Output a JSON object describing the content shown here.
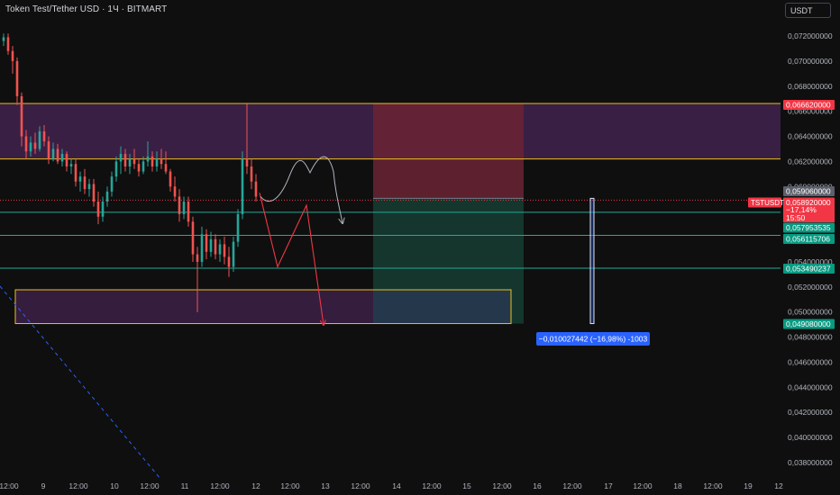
{
  "header": {
    "title": "Token Test/Tether USD · 1Ч · BITMART",
    "currency_button": "USDT"
  },
  "colors": {
    "up": "#26a69a",
    "down": "#ef5350",
    "zone_purple": "#3a1f44",
    "zone_red": "#6b2334",
    "zone_green": "#14362d",
    "line_yellow": "#e8c21a",
    "line_teal": "#22ab94",
    "line_red_dotted": "#f23645",
    "measure_blue": "#2962ff"
  },
  "chart_data": {
    "type": "candlestick",
    "symbol": "TSTUSDT",
    "y_ticks": [
      "0,072000000",
      "0,070000000",
      "0,068000000",
      "0,066000000",
      "0,064000000",
      "0,062000000",
      "0,060000000",
      "0,058000000",
      "0,056000000",
      "0,054000000",
      "0,052000000",
      "0,050000000",
      "0,048000000",
      "0,046000000",
      "0,044000000",
      "0,042000000",
      "0,040000000",
      "0,038000000"
    ],
    "x_ticks": [
      "12:00",
      "9",
      "12:00",
      "10",
      "12:00",
      "11",
      "12:00",
      "12",
      "12:00",
      "13",
      "12:00",
      "14",
      "12:00",
      "15",
      "12:00",
      "16",
      "12:00",
      "17",
      "12:00",
      "18",
      "12:00",
      "19",
      "12"
    ],
    "ylim": [
      0.0376,
      0.0738
    ],
    "levels": {
      "resistance_top": 0.06662,
      "resistance_bottom": 0.0622,
      "entry": 0.05906,
      "last_price": 0.05892,
      "tp1": 0.057953535,
      "tp2": 0.056115706,
      "tp3": 0.053490237,
      "target": 0.04908
    },
    "price_labels": [
      {
        "text": "0,066620000",
        "color": "#f23645",
        "value": 0.06662
      },
      {
        "text": "0,059060000",
        "color": "#5d606b",
        "value": 0.05906
      },
      {
        "text": "0,058920000",
        "color": "#f23645",
        "value": 0.05892
      },
      {
        "text": "0,057953535",
        "color": "#089981",
        "value": 0.057953535
      },
      {
        "text": "0,056115706",
        "color": "#089981",
        "value": 0.056115706
      },
      {
        "text": "0,053490237",
        "color": "#089981",
        "value": 0.053490237
      },
      {
        "text": "0,049080000",
        "color": "#089981",
        "value": 0.04908
      }
    ],
    "last_price_change": "−17,14%",
    "countdown": "15:50",
    "measure_label": "−0,010027442 (−16,98%) -1003",
    "candles": [
      [
        0.0716,
        0.0722,
        0.0712,
        0.0719
      ],
      [
        0.0719,
        0.0722,
        0.0705,
        0.0708
      ],
      [
        0.0708,
        0.0712,
        0.069,
        0.07
      ],
      [
        0.07,
        0.0703,
        0.0665,
        0.0672
      ],
      [
        0.0672,
        0.0675,
        0.0632,
        0.064
      ],
      [
        0.064,
        0.0645,
        0.0622,
        0.0628
      ],
      [
        0.0628,
        0.064,
        0.0624,
        0.0635
      ],
      [
        0.0635,
        0.0643,
        0.0626,
        0.063
      ],
      [
        0.063,
        0.0648,
        0.0628,
        0.0644
      ],
      [
        0.0644,
        0.0649,
        0.0632,
        0.0636
      ],
      [
        0.0636,
        0.064,
        0.0618,
        0.0622
      ],
      [
        0.0622,
        0.0635,
        0.062,
        0.063
      ],
      [
        0.063,
        0.0634,
        0.0618,
        0.062
      ],
      [
        0.062,
        0.063,
        0.0616,
        0.0626
      ],
      [
        0.0626,
        0.0628,
        0.0612,
        0.0616
      ],
      [
        0.0616,
        0.0622,
        0.061,
        0.0618
      ],
      [
        0.0618,
        0.0622,
        0.06,
        0.0604
      ],
      [
        0.0604,
        0.0612,
        0.0596,
        0.0608
      ],
      [
        0.0608,
        0.0614,
        0.0594,
        0.0598
      ],
      [
        0.0598,
        0.0606,
        0.0592,
        0.0602
      ],
      [
        0.0602,
        0.0606,
        0.0584,
        0.0588
      ],
      [
        0.0588,
        0.0596,
        0.057,
        0.0576
      ],
      [
        0.0576,
        0.0592,
        0.0572,
        0.0588
      ],
      [
        0.0588,
        0.06,
        0.0584,
        0.0596
      ],
      [
        0.0596,
        0.0612,
        0.0592,
        0.0608
      ],
      [
        0.0608,
        0.0624,
        0.0604,
        0.062
      ],
      [
        0.062,
        0.0632,
        0.061,
        0.0626
      ],
      [
        0.0626,
        0.063,
        0.0612,
        0.0616
      ],
      [
        0.0616,
        0.0626,
        0.061,
        0.0622
      ],
      [
        0.0622,
        0.063,
        0.0614,
        0.0618
      ],
      [
        0.0618,
        0.0622,
        0.0608,
        0.0612
      ],
      [
        0.0612,
        0.0624,
        0.061,
        0.062
      ],
      [
        0.062,
        0.0636,
        0.0616,
        0.0624
      ],
      [
        0.0624,
        0.0628,
        0.0612,
        0.0616
      ],
      [
        0.0616,
        0.0628,
        0.0612,
        0.0622
      ],
      [
        0.0622,
        0.063,
        0.0614,
        0.0618
      ],
      [
        0.0618,
        0.0628,
        0.061,
        0.0612
      ],
      [
        0.0612,
        0.0614,
        0.0596,
        0.06
      ],
      [
        0.06,
        0.0608,
        0.0588,
        0.0592
      ],
      [
        0.0592,
        0.0598,
        0.0572,
        0.0578
      ],
      [
        0.0578,
        0.0592,
        0.0574,
        0.0588
      ],
      [
        0.0588,
        0.0592,
        0.0568,
        0.0572
      ],
      [
        0.0572,
        0.0576,
        0.054,
        0.0546
      ],
      [
        0.0546,
        0.0552,
        0.05,
        0.054
      ],
      [
        0.054,
        0.0568,
        0.0536,
        0.0562
      ],
      [
        0.0562,
        0.0566,
        0.0542,
        0.0548
      ],
      [
        0.0548,
        0.0564,
        0.0544,
        0.0558
      ],
      [
        0.0558,
        0.0562,
        0.0542,
        0.0546
      ],
      [
        0.0546,
        0.0558,
        0.054,
        0.0554
      ],
      [
        0.0554,
        0.056,
        0.0538,
        0.0544
      ],
      [
        0.0544,
        0.0552,
        0.0528,
        0.0536
      ],
      [
        0.0536,
        0.056,
        0.0532,
        0.0556
      ],
      [
        0.0556,
        0.0582,
        0.0552,
        0.0578
      ],
      [
        0.0578,
        0.0628,
        0.0574,
        0.0622
      ],
      [
        0.0622,
        0.0666,
        0.061,
        0.0616
      ],
      [
        0.0616,
        0.0622,
        0.0598,
        0.0604
      ],
      [
        0.0604,
        0.061,
        0.0588,
        0.0592
      ]
    ]
  }
}
